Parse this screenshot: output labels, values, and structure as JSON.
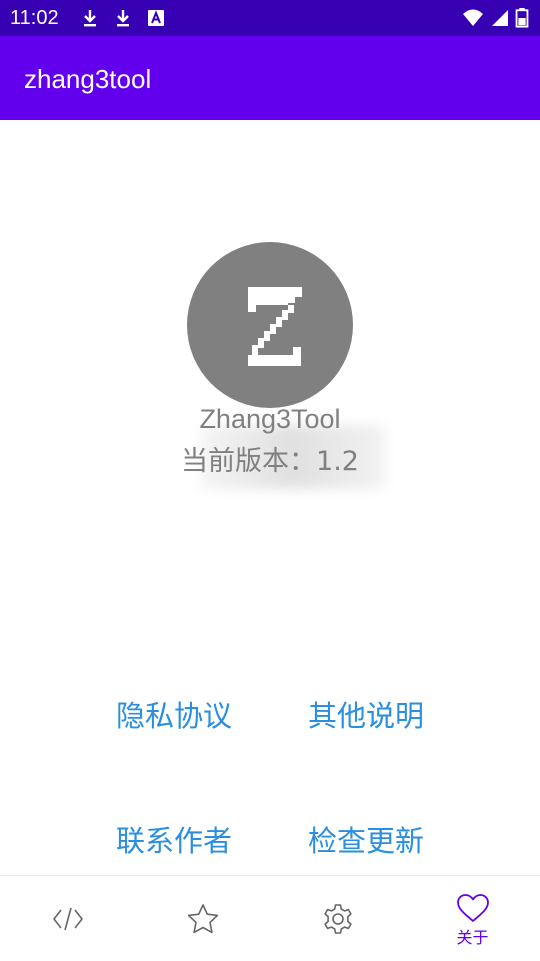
{
  "status_bar": {
    "time": "11:02",
    "icons": [
      "download-icon",
      "download-icon",
      "a-badge-icon",
      "wifi-icon",
      "signal-icon",
      "battery-icon"
    ],
    "background_color": "#3700B3"
  },
  "app_bar": {
    "title": "zhang3tool",
    "background_color": "#6200EE"
  },
  "about": {
    "logo_icon": "z-logo-icon",
    "app_name": "Zhang3Tool",
    "version_text": "当前版本：1.2"
  },
  "links": {
    "privacy": "隐私协议",
    "other_notes": "其他说明",
    "contact_author": "联系作者",
    "check_update": "检查更新",
    "color": "#2A8FE0"
  },
  "bottom_nav": {
    "items": [
      {
        "icon": "code-icon",
        "active": false
      },
      {
        "icon": "star-icon",
        "active": false
      },
      {
        "icon": "gear-icon",
        "active": false
      },
      {
        "icon": "heart-icon",
        "label": "关于",
        "active": true
      }
    ],
    "active_color": "#6200EE",
    "inactive_color": "#666666"
  }
}
